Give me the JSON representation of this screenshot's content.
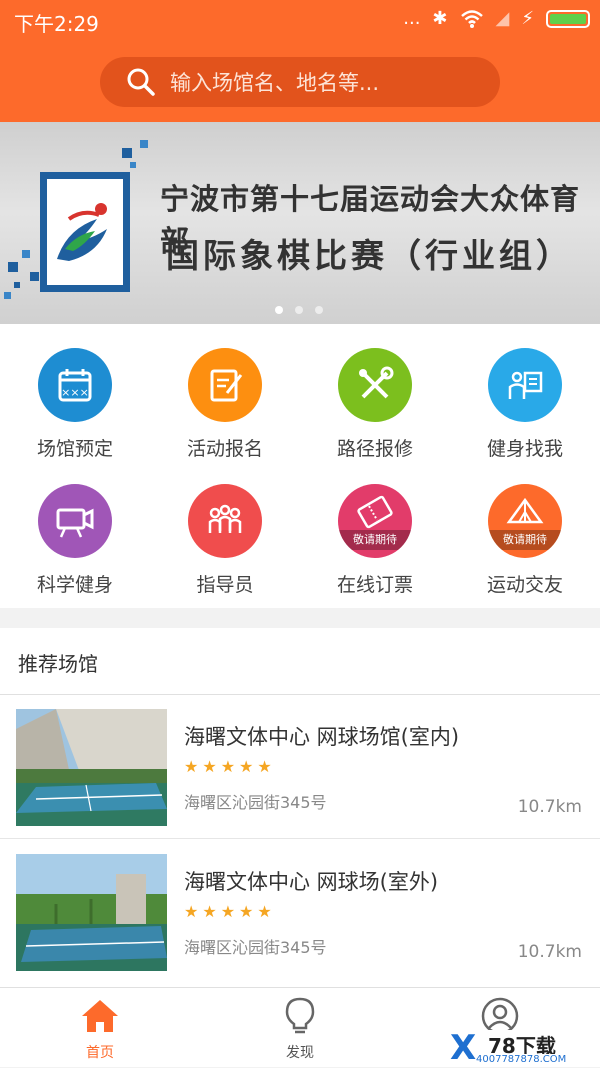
{
  "status_bar": {
    "time": "下午2:29",
    "dots": "...",
    "bluetooth": "✱",
    "signal": "◢",
    "charge": "⚡"
  },
  "search": {
    "placeholder": "输入场馆名、地名等..."
  },
  "banner": {
    "line1": "宁波市第十七届运动会大众体育部",
    "line2": "国际象棋比赛（行业组）",
    "slide_count": 3,
    "active_slide": 1
  },
  "grid": {
    "items": [
      {
        "label": "场馆预定",
        "icon": "calendar-icon",
        "color": "#1e8dd2"
      },
      {
        "label": "活动报名",
        "icon": "edit-note-icon",
        "color": "#fd8f10"
      },
      {
        "label": "路径报修",
        "icon": "tools-icon",
        "color": "#7cbf1e"
      },
      {
        "label": "健身找我",
        "icon": "coach-card-icon",
        "color": "#29a9e8"
      },
      {
        "label": "科学健身",
        "icon": "video-camera-icon",
        "color": "#a056b7"
      },
      {
        "label": "指导员",
        "icon": "people-icon",
        "color": "#f04d4d"
      },
      {
        "label": "在线订票",
        "icon": "ticket-icon",
        "color": "#e23c6a",
        "ribbon": "敬请期待"
      },
      {
        "label": "运动交友",
        "icon": "tent-icon",
        "color": "#fd6a2b",
        "ribbon": "敬请期待"
      }
    ]
  },
  "recommend": {
    "title": "推荐场馆",
    "venues": [
      {
        "name": "海曙文体中心 网球场馆(室内)",
        "rating": 5,
        "address": "海曙区沁园街345号",
        "distance": "10.7km"
      },
      {
        "name": "海曙文体中心 网球场(室外)",
        "rating": 5,
        "address": "海曙区沁园街345号",
        "distance": "10.7km"
      }
    ]
  },
  "tabbar": {
    "tabs": [
      {
        "label": "首页",
        "icon": "home-icon",
        "active": true
      },
      {
        "label": "发现",
        "icon": "lightbulb-icon",
        "active": false
      },
      {
        "label": "",
        "icon": "user-icon",
        "active": false
      }
    ]
  },
  "watermark": {
    "mark": "X",
    "text": "78下载",
    "url": "4007787878.COM"
  },
  "colors": {
    "accent": "#fd6a2b",
    "search_bg": "#e2531c",
    "star": "#f5a623"
  }
}
